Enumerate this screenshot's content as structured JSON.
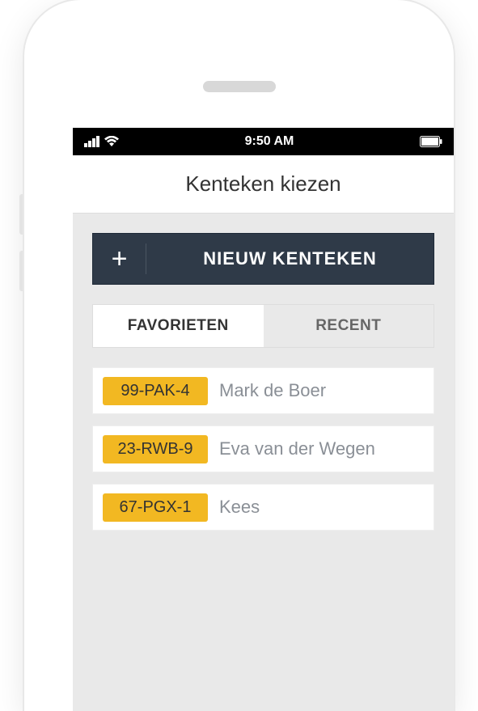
{
  "status": {
    "time": "9:50 AM"
  },
  "header": {
    "title": "Kenteken kiezen"
  },
  "newButton": {
    "label": "NIEUW KENTEKEN"
  },
  "tabs": {
    "favorites": "FAVORIETEN",
    "recent": "RECENT"
  },
  "plates": [
    {
      "plate": "99-PAK-4",
      "name": "Mark de Boer"
    },
    {
      "plate": "23-RWB-9",
      "name": "Eva van der Wegen"
    },
    {
      "plate": "67-PGX-1",
      "name": "Kees"
    }
  ]
}
